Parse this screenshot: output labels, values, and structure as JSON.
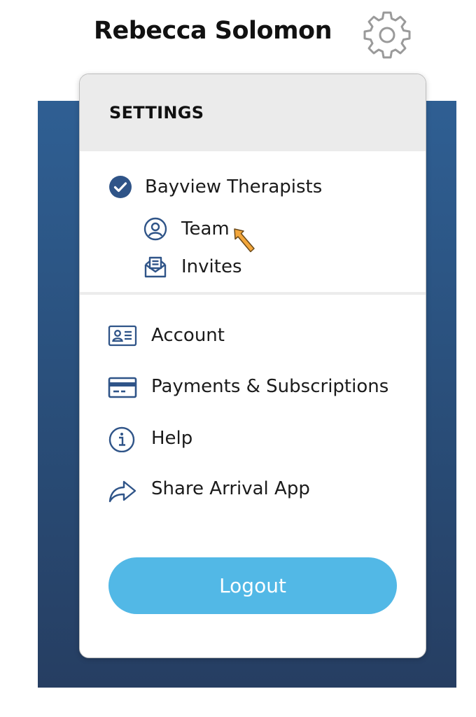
{
  "header": {
    "user_name": "Rebecca Solomon",
    "settings_icon": "gear-icon"
  },
  "menu": {
    "title": "SETTINGS",
    "organization": {
      "label": "Bayview Therapists",
      "icon": "check-circle-icon",
      "selected": true,
      "sub_items": [
        {
          "label": "Team",
          "icon": "user-circle-icon"
        },
        {
          "label": "Invites",
          "icon": "envelope-open-icon"
        }
      ]
    },
    "items": [
      {
        "label": "Account",
        "icon": "id-card-icon"
      },
      {
        "label": "Payments & Subscriptions",
        "icon": "credit-card-icon"
      },
      {
        "label": "Help",
        "icon": "info-circle-icon"
      },
      {
        "label": "Share Arrival App",
        "icon": "share-arrow-icon"
      }
    ],
    "logout_label": "Logout"
  },
  "colors": {
    "icon_blue": "#2f5488",
    "panel_blue_top": "#2f5f93",
    "panel_blue_bottom": "#263e62",
    "logout_button": "#52b8e6",
    "header_bg": "#ebebeb",
    "cursor": "#f0a030"
  }
}
